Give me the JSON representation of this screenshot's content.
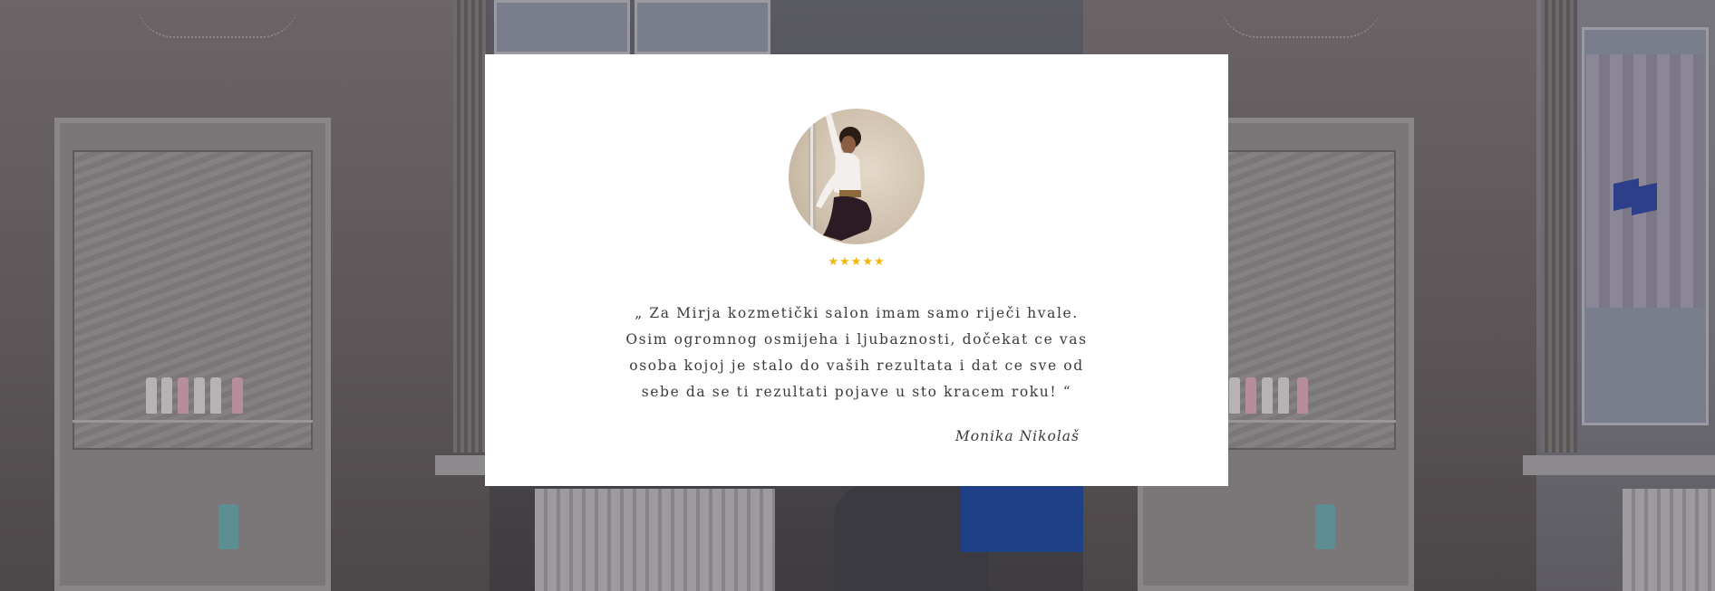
{
  "testimonial": {
    "avatar_icon": "person-photo",
    "rating": 5,
    "stars": "★★★★★",
    "quote": "„ Za Mirja kozmetički salon imam samo riječi hvale. Osim ogromnog osmijeha i ljubaznosti, dočekat ce vas osoba kojoj je stalo do vaših rezultata i dat ce sve od sebe da se ti rezultati pojave u sto kracem roku! “",
    "author": "Monika Nikolaš"
  },
  "colors": {
    "card_background": "#ffffff",
    "star": "#f2b705",
    "text": "#3b3b3b"
  }
}
